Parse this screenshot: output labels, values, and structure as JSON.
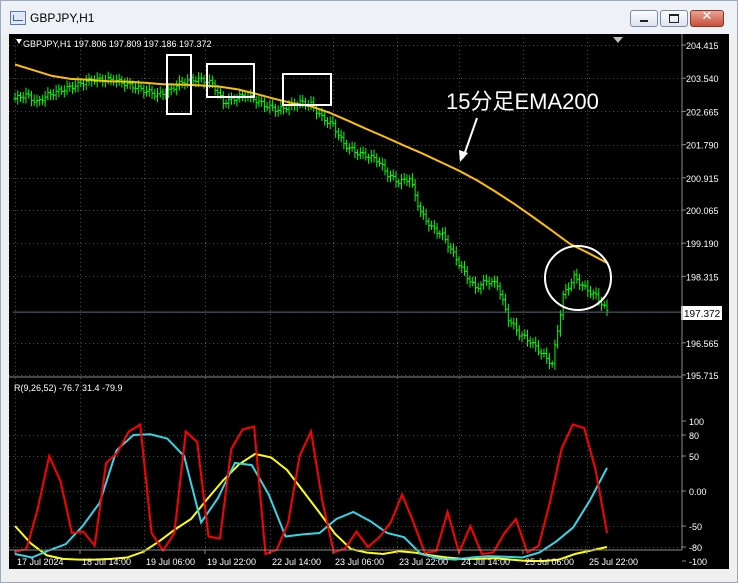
{
  "window": {
    "title": "GBPJPY,H1",
    "close_glyph": "✕"
  },
  "chart": {
    "ohlc_label": "GBPJPY,H1  197.806 197.809 197.186 197.372",
    "price_ticks": [
      "204.415",
      "203.540",
      "202.665",
      "201.790",
      "200.915",
      "200.065",
      "199.190",
      "198.315",
      "197.372",
      "196.565",
      "195.715"
    ],
    "current_price": "197.372",
    "annotation": "15分足EMA200",
    "indicator_label": "R(9,26,52) -76.7 31.4 -79.9",
    "indicator_ticks": [
      "100",
      "80",
      "50",
      "0.00",
      "-50",
      "-80",
      "-100"
    ],
    "time_labels": [
      "17 Jul 2024",
      "18 Jul 14:00",
      "19 Jul 06:00",
      "19 Jul 22:00",
      "22 Jul 14:00",
      "23 Jul 06:00",
      "23 Jul 22:00",
      "24 Jul 14:00",
      "25 Jul 06:00",
      "25 Jul 22:00"
    ],
    "colors": {
      "background": "#000000",
      "candle": "#00ff00",
      "ema": "#ffbf00",
      "rci_short": "#ff0000",
      "rci_mid": "#33d6e6",
      "rci_long": "#ffff00",
      "box": "#ffffff",
      "grid": "#4d4d4d"
    }
  },
  "chart_data": {
    "type": "line",
    "title": "GBPJPY,H1",
    "y_range": [
      195.715,
      204.415
    ],
    "indicator_range": [
      -100,
      100
    ],
    "price_close": [
      203.0,
      203.1,
      202.9,
      203.1,
      203.2,
      203.3,
      203.4,
      203.5,
      203.5,
      203.5,
      203.4,
      203.3,
      203.2,
      203.1,
      203.2,
      203.4,
      203.5,
      203.5,
      203.4,
      202.9,
      203.0,
      203.1,
      202.95,
      202.8,
      202.7,
      202.8,
      202.9,
      202.85,
      202.5,
      202.3,
      201.8,
      201.6,
      201.5,
      201.4,
      201.0,
      200.8,
      200.9,
      200.0,
      199.6,
      199.4,
      198.9,
      198.4,
      198.0,
      198.2,
      198.1,
      197.2,
      196.8,
      196.6,
      196.3,
      196.0,
      197.8,
      198.3,
      198.0,
      197.8,
      197.4
    ],
    "ema200": [
      203.9,
      203.75,
      203.6,
      203.52,
      203.5,
      203.46,
      203.45,
      203.42,
      203.38,
      203.37,
      203.35,
      203.32,
      203.25,
      203.13,
      203.0,
      202.88,
      202.8,
      202.63,
      202.42,
      202.2,
      201.99,
      201.77,
      201.56,
      201.33,
      201.1,
      200.84,
      200.54,
      200.22,
      199.88,
      199.53,
      199.17,
      198.93,
      198.67
    ],
    "series": [
      {
        "name": "R(9)",
        "values": [
          -87,
          -83,
          -25,
          50,
          14,
          -60,
          -58,
          -78,
          40,
          55,
          85,
          95,
          -60,
          -85,
          -60,
          85,
          70,
          -65,
          -68,
          60,
          88,
          92,
          -90,
          -84,
          -45,
          50,
          85,
          -15,
          -88,
          -82,
          -58,
          -80,
          -66,
          -45,
          -5,
          -45,
          -88,
          -86,
          -30,
          -88,
          -50,
          -90,
          -88,
          -60,
          -40,
          -88,
          -78,
          -15,
          60,
          95,
          90,
          30,
          -60
        ]
      },
      {
        "name": "R(26)",
        "values": [
          -90,
          -95,
          -85,
          -76,
          -50,
          -17,
          58,
          80,
          81,
          75,
          50,
          -45,
          -10,
          40,
          37,
          -5,
          -65,
          -62,
          -60,
          -40,
          -30,
          -43,
          -60,
          -66,
          -90,
          -96,
          -98,
          -95,
          -93,
          -94,
          -95,
          -88,
          -72,
          -52,
          -13,
          33
        ]
      },
      {
        "name": "R(52)",
        "values": [
          -50,
          -75,
          -92,
          -97,
          -98,
          -98,
          -97,
          -95,
          -87,
          -72,
          -55,
          -40,
          -12,
          15,
          38,
          53,
          48,
          30,
          0,
          -30,
          -61,
          -83,
          -88,
          -90,
          -86,
          -88,
          -92,
          -95,
          -97,
          -97,
          -96,
          -98,
          -100,
          -100,
          -98,
          -90,
          -85,
          -80
        ]
      }
    ]
  }
}
